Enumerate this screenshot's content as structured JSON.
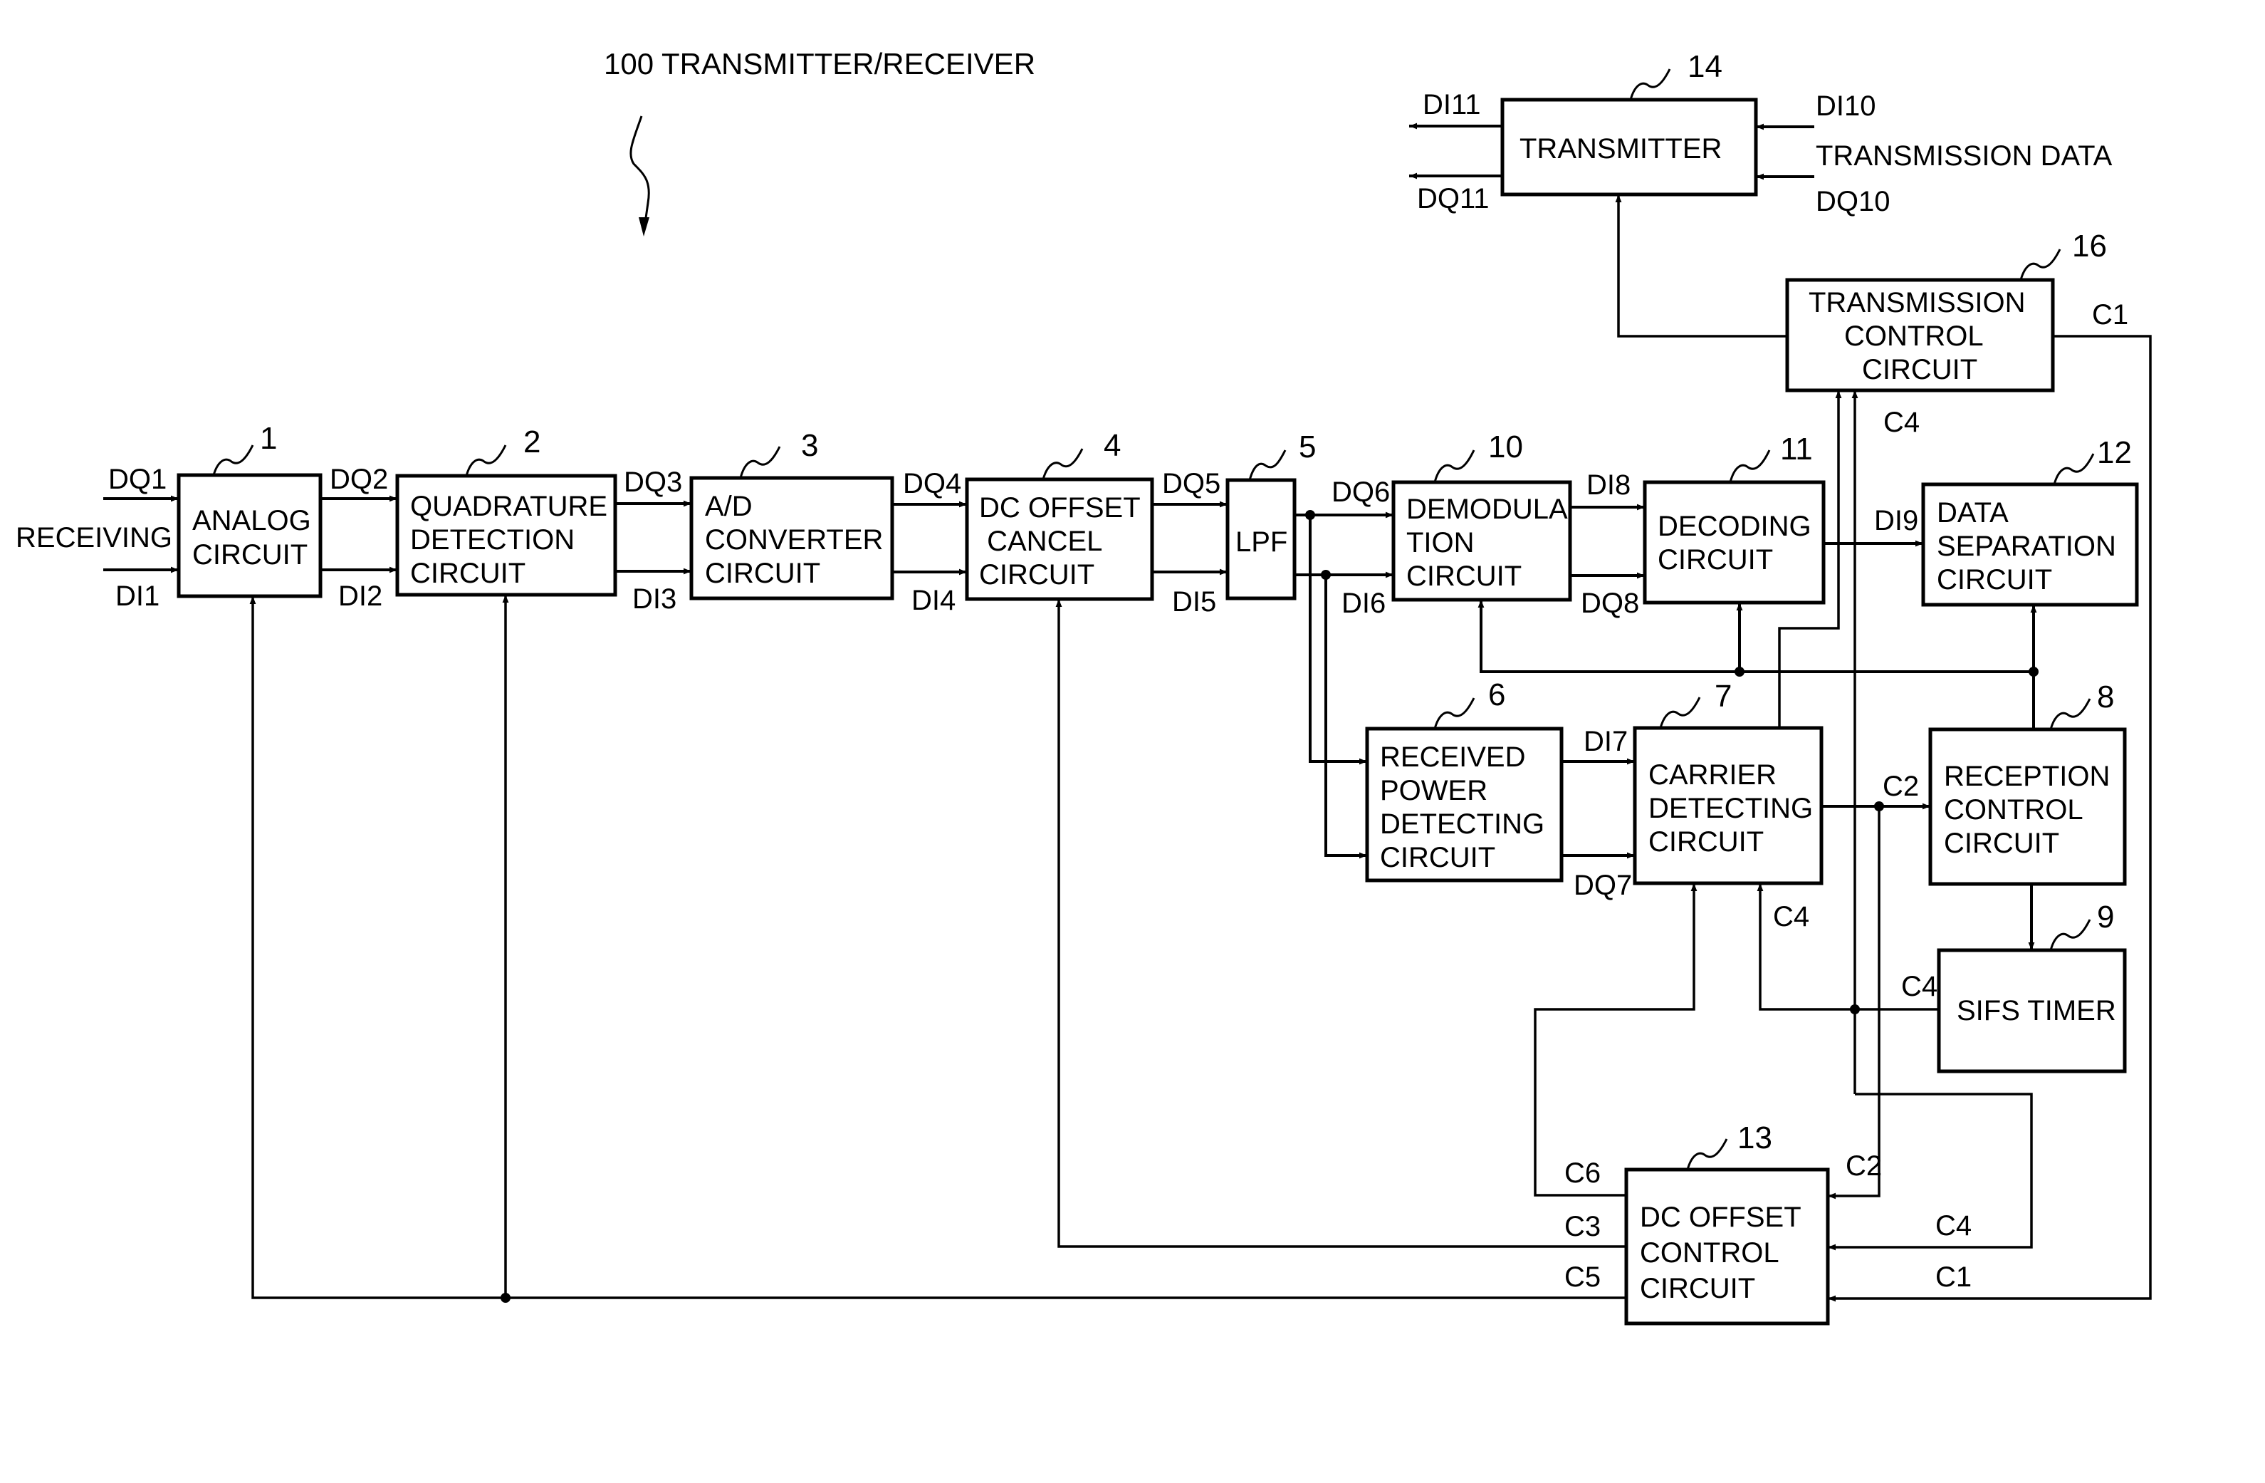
{
  "title": "100 TRANSMITTER/RECEIVER",
  "input_label": "RECEIVING",
  "transmission_data_label": "TRANSMISSION DATA",
  "blocks": {
    "analog": {
      "ref": "1",
      "lines": [
        "ANALOG",
        "CIRCUIT"
      ]
    },
    "quadrature": {
      "ref": "2",
      "lines": [
        "QUADRATURE",
        "DETECTION",
        "CIRCUIT"
      ]
    },
    "adc": {
      "ref": "3",
      "lines": [
        "A/D",
        "CONVERTER",
        "CIRCUIT"
      ]
    },
    "dc_cancel": {
      "ref": "4",
      "lines": [
        "DC OFFSET",
        " CANCEL",
        "CIRCUIT"
      ]
    },
    "lpf": {
      "ref": "5",
      "lines": [
        "LPF"
      ]
    },
    "power_detect": {
      "ref": "6",
      "lines": [
        "RECEIVED",
        "POWER",
        "DETECTING",
        "CIRCUIT"
      ]
    },
    "carrier_detect": {
      "ref": "7",
      "lines": [
        "CARRIER",
        "DETECTING",
        "CIRCUIT"
      ]
    },
    "reception_ctrl": {
      "ref": "8",
      "lines": [
        "RECEPTION",
        "CONTROL",
        "CIRCUIT"
      ]
    },
    "sifs": {
      "ref": "9",
      "lines": [
        "SIFS TIMER"
      ]
    },
    "demod": {
      "ref": "10",
      "lines": [
        "DEMODULA",
        "TION",
        "CIRCUIT"
      ]
    },
    "decode": {
      "ref": "11",
      "lines": [
        "DECODING",
        "CIRCUIT"
      ]
    },
    "data_sep": {
      "ref": "12",
      "lines": [
        "DATA",
        "SEPARATION",
        "CIRCUIT"
      ]
    },
    "dc_ctrl": {
      "ref": "13",
      "lines": [
        "DC OFFSET",
        "CONTROL",
        "CIRCUIT"
      ]
    },
    "transmitter": {
      "ref": "14",
      "lines": [
        "TRANSMITTER"
      ]
    },
    "tx_ctrl": {
      "ref": "16",
      "lines": [
        "TRANSMISSION",
        "CONTROL",
        "CIRCUIT"
      ]
    }
  },
  "signals": {
    "DQ1": "DQ1",
    "DI1": "DI1",
    "DQ2": "DQ2",
    "DI2": "DI2",
    "DQ3": "DQ3",
    "DI3": "DI3",
    "DQ4": "DQ4",
    "DI4": "DI4",
    "DQ5": "DQ5",
    "DI5": "DI5",
    "DQ6": "DQ6",
    "DI6": "DI6",
    "DI7": "DI7",
    "DQ7": "DQ7",
    "DI8": "DI8",
    "DQ8": "DQ8",
    "DI9": "DI9",
    "DI10": "DI10",
    "DQ10": "DQ10",
    "DI11": "DI11",
    "DQ11": "DQ11",
    "C1_tx": "C1",
    "C1_dc": "C1",
    "C2_carrier": "C2",
    "C2_dc": "C2",
    "C3": "C3",
    "C4_tx": "C4",
    "C4_carrier": "C4",
    "C4_sifs": "C4",
    "C4_dc": "C4",
    "C5": "C5",
    "C6": "C6"
  }
}
